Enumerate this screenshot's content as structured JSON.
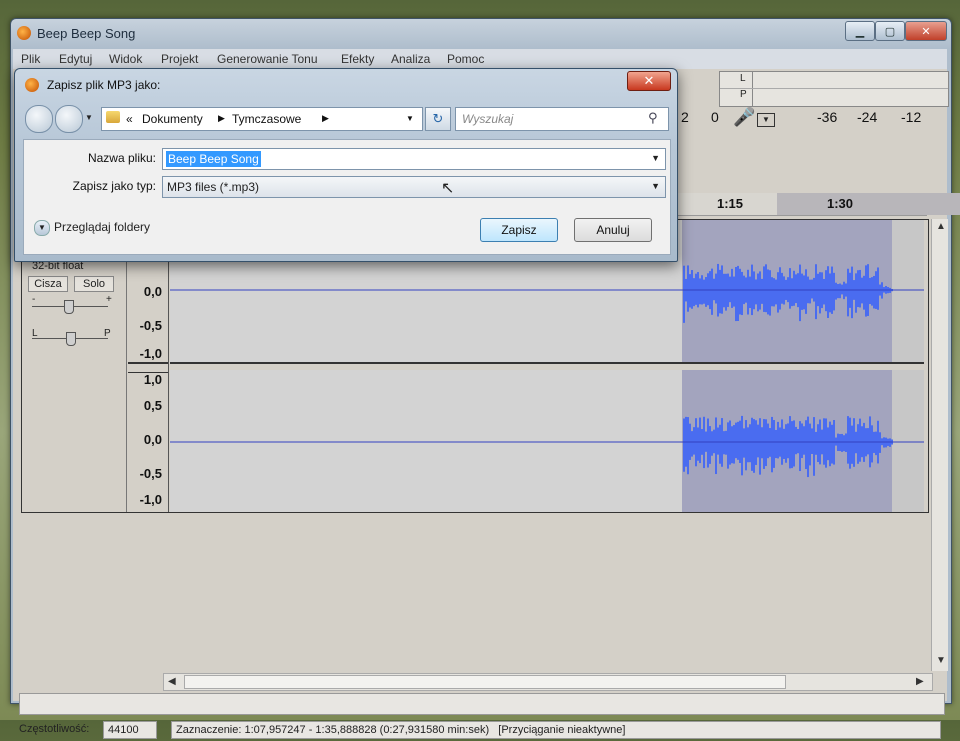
{
  "main_window": {
    "title": "Beep Beep Song",
    "menu": [
      "Plik",
      "Edytuj",
      "Widok",
      "Projekt",
      "Generowanie Tonu",
      "Efekty",
      "Analiza",
      "Pomoc"
    ]
  },
  "meter": {
    "left_label": "L",
    "right_label": "P",
    "scale": [
      "2",
      "0",
      "-36",
      "-24",
      "-12"
    ]
  },
  "ruler": {
    "labels": [
      "1:15",
      "1:30"
    ]
  },
  "track": {
    "format": "32-bit float",
    "mute_label": "Cisza",
    "solo_label": "Solo",
    "gain_minus": "-",
    "gain_plus": "+",
    "pan_left": "L",
    "pan_right": "P",
    "ch1_ticks": [
      "0,0",
      "-0,5",
      "-1,0"
    ],
    "ch2_ticks": [
      "1,0",
      "0,5",
      "0,0",
      "-0,5",
      "-1,0"
    ]
  },
  "statusbar": {
    "rate_label": "Częstotliwość:",
    "rate_value": "44100",
    "selection_text": "Zaznaczenie: 1:07,957247 - 1:35,888828 (0:27,931580 min:sek)",
    "snap_text": "[Przyciąganie nieaktywne]"
  },
  "dialog": {
    "title": "Zapisz plik MP3 jako:",
    "close_symbol": "✕",
    "breadcrumb": {
      "prefix": "«",
      "items": [
        "Dokumenty",
        "Tymczasowe"
      ]
    },
    "search_placeholder": "Wyszukaj",
    "filename_label": "Nazwa pliku:",
    "filename_value": "Beep Beep Song",
    "filetype_label": "Zapisz jako typ:",
    "filetype_value": "MP3 files (*.mp3)",
    "browse_folders": "Przeglądaj foldery",
    "save_button": "Zapisz",
    "cancel_button": "Anuluj"
  },
  "colors": {
    "selection": "#a3a4be",
    "waveform": "#4a6cf0",
    "highlight": "#3399ff"
  },
  "icons": [
    "app-icon",
    "back-icon",
    "forward-icon",
    "folder-icon",
    "refresh-icon",
    "search-icon",
    "microphone-icon",
    "mouse-cursor-icon"
  ]
}
